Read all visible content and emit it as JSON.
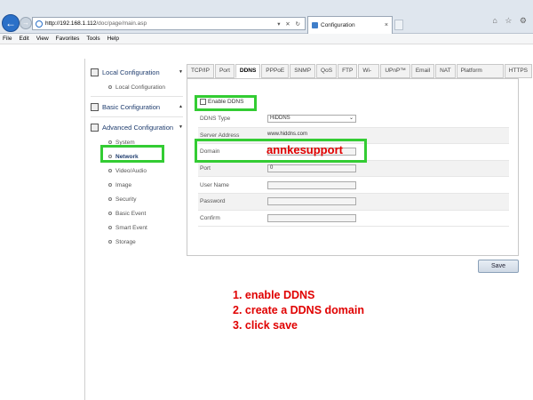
{
  "browser": {
    "url_host": "http://192.168.1.112",
    "url_path": "/doc/page/main.asp",
    "url_controls": "▾ ✕ ↻",
    "tab_title": "Configuration",
    "window_controls": "⌂ ☆ ⚙"
  },
  "menubar": [
    "File",
    "Edit",
    "View",
    "Favorites",
    "Tools",
    "Help"
  ],
  "sidebar": {
    "local": {
      "label": "Local Configuration",
      "items": [
        "Local Configuration"
      ]
    },
    "basic": {
      "label": "Basic Configuration"
    },
    "advanced": {
      "label": "Advanced Configuration",
      "items": [
        "System",
        "Network",
        "Video/Audio",
        "Image",
        "Security",
        "Basic Event",
        "Smart Event",
        "Storage"
      ]
    }
  },
  "tabs": [
    "TCP/IP",
    "Port",
    "DDNS",
    "PPPoE",
    "SNMP",
    "QoS",
    "FTP",
    "Wi-Fi",
    "UPnP™",
    "Email",
    "NAT",
    "Platform Access",
    "HTTPS"
  ],
  "active_tab": "DDNS",
  "form": {
    "enable_label": "Enable DDNS",
    "ddns_type_label": "DDNS Type",
    "ddns_type_value": "HiDDNS",
    "server_label": "Server Address",
    "server_value": "www.hiddns.com",
    "domain_label": "Domain",
    "port_label": "Port",
    "port_value": "0",
    "username_label": "User Name",
    "password_label": "Password",
    "confirm_label": "Confirm"
  },
  "save_label": "Save",
  "annotations": {
    "domain_text": "annkesupport",
    "steps": [
      "1. enable DDNS",
      "2. create a DDNS domain",
      "3. click save"
    ]
  },
  "colors": {
    "highlight": "#33cc33",
    "annotation": "#e00000",
    "sidebar_text": "#1e3c6e"
  }
}
